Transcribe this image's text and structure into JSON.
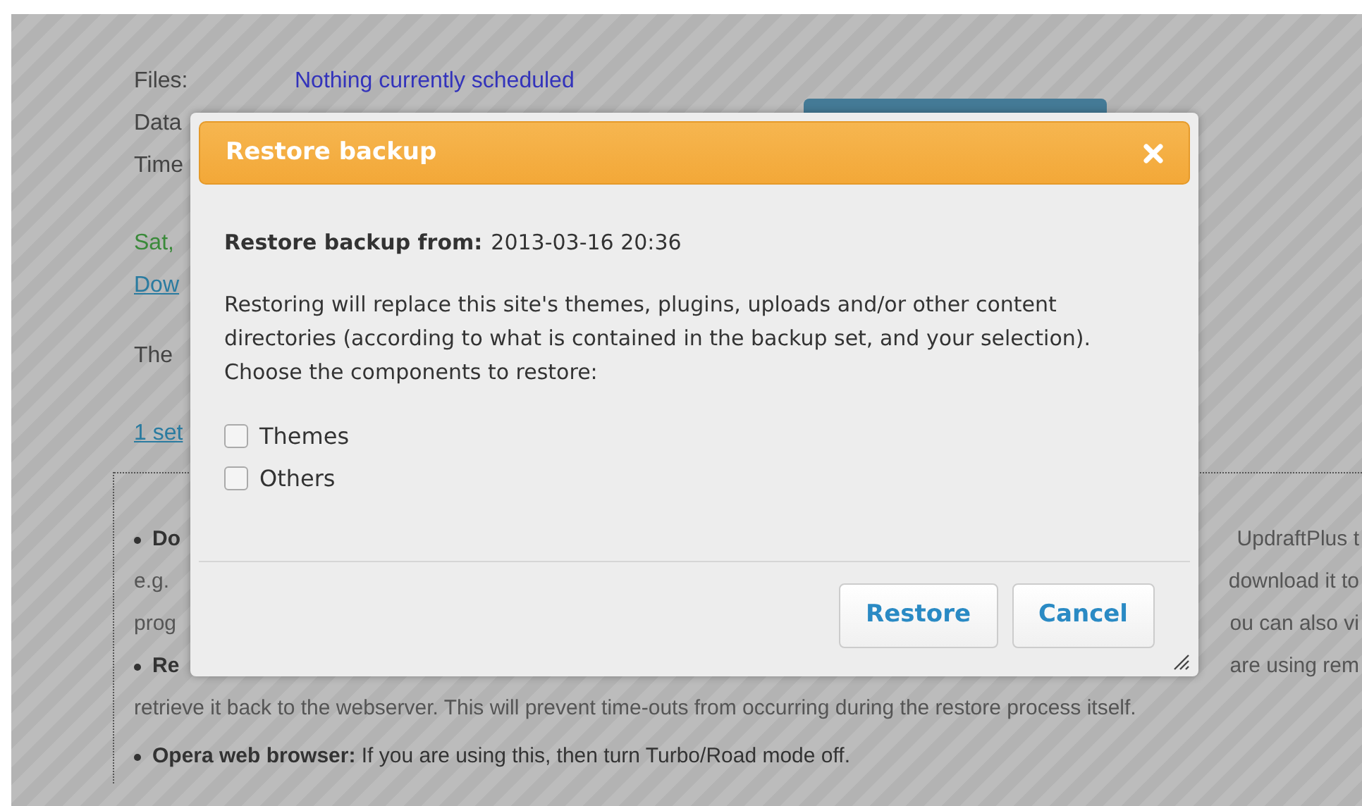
{
  "page": {
    "schedule_labels": [
      "Files:",
      "Data",
      "Time"
    ],
    "schedule_value": "Nothing currently scheduled",
    "status_text": "Sat,",
    "download_link": "Dow",
    "info_text": "The",
    "sets_link": "1 set",
    "notes": [
      {
        "kind": "bullet",
        "left": "Do",
        "right": "UpdraftPlus t"
      },
      {
        "kind": "line",
        "left": "e.g.",
        "right": "download it to"
      },
      {
        "kind": "line",
        "left": "prog",
        "right": "ou can also vi"
      },
      {
        "kind": "bullet",
        "left": "Re",
        "right": "are using rem"
      },
      {
        "kind": "full",
        "text": "retrieve it back to the webserver. This will prevent time-outs from occurring during the restore process itself."
      },
      {
        "kind": "bullet_full",
        "text": "**Opera web browser:** If you are using this, then turn Turbo/Road mode off."
      }
    ]
  },
  "dialog": {
    "title": "Restore backup",
    "from_label": "Restore backup from:",
    "from_value": "2013-03-16 20:36",
    "description": "Restoring will replace this site's themes, plugins, uploads and/or other content directories (according to what is contained in the backup set, and your selection). Choose the components to restore:",
    "components": [
      {
        "label": "Themes",
        "checked": false
      },
      {
        "label": "Others",
        "checked": false
      }
    ],
    "buttons": [
      "Restore",
      "Cancel"
    ]
  }
}
